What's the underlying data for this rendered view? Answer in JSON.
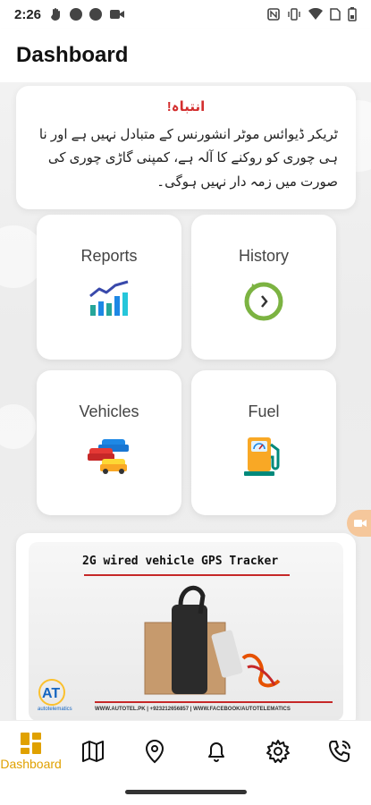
{
  "status_bar": {
    "time": "2:26",
    "left_icons": [
      "hand-icon",
      "circle-icon",
      "circle-icon",
      "video-icon"
    ],
    "right_icons": [
      "nfc-icon",
      "vibrate-icon",
      "wifi-icon",
      "sim-icon",
      "battery-icon"
    ]
  },
  "app_bar": {
    "title": "Dashboard"
  },
  "warning": {
    "title": "انتباہ!",
    "body": "ٹریکر ڈیوائس موٹر انشورنس کے متبادل نہیں ہے اور نا ہی چوری کو روکنے کا آلہ ہے، کمپنی گاڑی چوری کی صورت میں زمہ دار نہیں ہوگی۔"
  },
  "tiles": [
    {
      "label": "Reports",
      "icon": "bar-chart-icon"
    },
    {
      "label": "History",
      "icon": "history-clock-icon"
    },
    {
      "label": "Vehicles",
      "icon": "cars-icon"
    },
    {
      "label": "Fuel",
      "icon": "fuel-pump-icon"
    }
  ],
  "banner": {
    "title": "2G wired vehicle GPS Tracker",
    "brand": "AT autotelematics",
    "footer": "WWW.AUTOTEL.PK | +923212656857 | WWW.FACEBOOK/AUTOTELEMATICS"
  },
  "bottom_nav": {
    "items": [
      {
        "label": "Dashboard",
        "icon": "dashboard-grid-icon",
        "active": true
      },
      {
        "label": "",
        "icon": "map-icon",
        "active": false
      },
      {
        "label": "",
        "icon": "location-pin-icon",
        "active": false
      },
      {
        "label": "",
        "icon": "bell-icon",
        "active": false
      },
      {
        "label": "",
        "icon": "gear-icon",
        "active": false
      },
      {
        "label": "",
        "icon": "phone-icon",
        "active": false
      }
    ]
  },
  "colors": {
    "accent": "#e0a100",
    "warning_red": "#d32f2f",
    "reports_blue": "#1e88e5",
    "history_green": "#7cb342"
  }
}
